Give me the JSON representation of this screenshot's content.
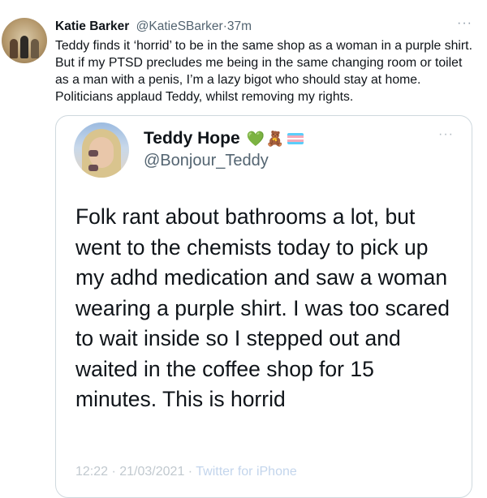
{
  "tweet": {
    "author_name": "Katie Barker",
    "handle": "@KatieSBarker",
    "separator": "·",
    "time": "37m",
    "more_label": "···",
    "text": "Teddy finds it ‘horrid’ to be in the same shop as a woman in a purple shirt. But if my PTSD precludes me being in the same changing room or toilet as a man with a penis, I’m a lazy bigot who should stay at home. Politicians applaud Teddy, whilst removing my rights.",
    "avatar_icon": "vintage-photo-avatar"
  },
  "quoted": {
    "author_name": "Teddy Hope",
    "emoji_heart": "💚",
    "emoji_bear": "🧸",
    "flag_colors": [
      "#5bcefa",
      "#f5a9b8",
      "#ffffff",
      "#f5a9b8",
      "#5bcefa"
    ],
    "handle": "@Bonjour_Teddy",
    "more_label": "···",
    "text": "Folk rant about bathrooms a lot, but went to the chemists today to pick up my adhd medication and saw a woman wearing a purple shirt.  I was too scared to wait inside so I stepped out and waited in the coffee shop for 15 minutes. This is horrid",
    "footer_meta": "12:22 · 21/03/2021 · ",
    "footer_source": "Twitter for iPhone"
  }
}
